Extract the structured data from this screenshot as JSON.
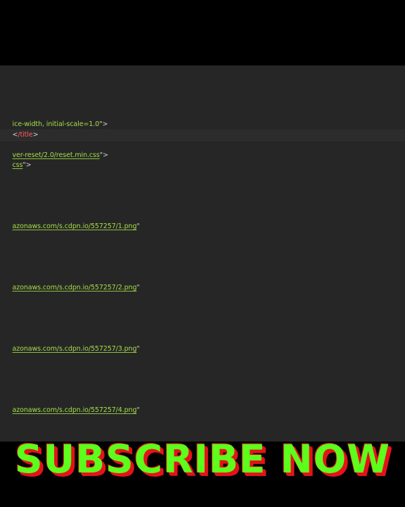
{
  "editor": {
    "lines": [
      {
        "parts": [
          {
            "text": "ice-width, initial-scale=1.0",
            "cls": "strplain"
          },
          {
            "text": "\">",
            "cls": "punc"
          }
        ]
      },
      {
        "parts": [
          {
            "text": "<",
            "cls": "punc"
          },
          {
            "text": "/title",
            "cls": "tag"
          },
          {
            "text": ">",
            "cls": "punc"
          }
        ]
      },
      {
        "parts": [
          {
            "text": "ver-reset/2.0/reset.min.css",
            "cls": "str"
          },
          {
            "text": "\">",
            "cls": "punc"
          }
        ]
      },
      {
        "parts": [
          {
            "text": "css",
            "cls": "str"
          },
          {
            "text": "\">",
            "cls": "punc"
          }
        ]
      },
      {
        "parts": [
          {
            "text": "azonaws.com/s.cdpn.io/557257/1.png",
            "cls": "str"
          },
          {
            "text": "\"",
            "cls": "punc"
          }
        ]
      },
      {
        "parts": [
          {
            "text": "azonaws.com/s.cdpn.io/557257/2.png",
            "cls": "str"
          },
          {
            "text": "\"",
            "cls": "punc"
          }
        ]
      },
      {
        "parts": [
          {
            "text": "azonaws.com/s.cdpn.io/557257/3.png",
            "cls": "str"
          },
          {
            "text": "\"",
            "cls": "punc"
          }
        ]
      },
      {
        "parts": [
          {
            "text": "azonaws.com/s.cdpn.io/557257/4.png",
            "cls": "str"
          },
          {
            "text": "\"",
            "cls": "punc"
          }
        ]
      }
    ]
  },
  "overlay": {
    "subscribe_text": "SUBSCRIBE NOW"
  },
  "colors": {
    "editor_bg": "#262626",
    "string": "#a6dd4a",
    "tag": "#ff5c5c",
    "overlay_text": "#5cff1c",
    "overlay_outline": "#e6121a"
  }
}
